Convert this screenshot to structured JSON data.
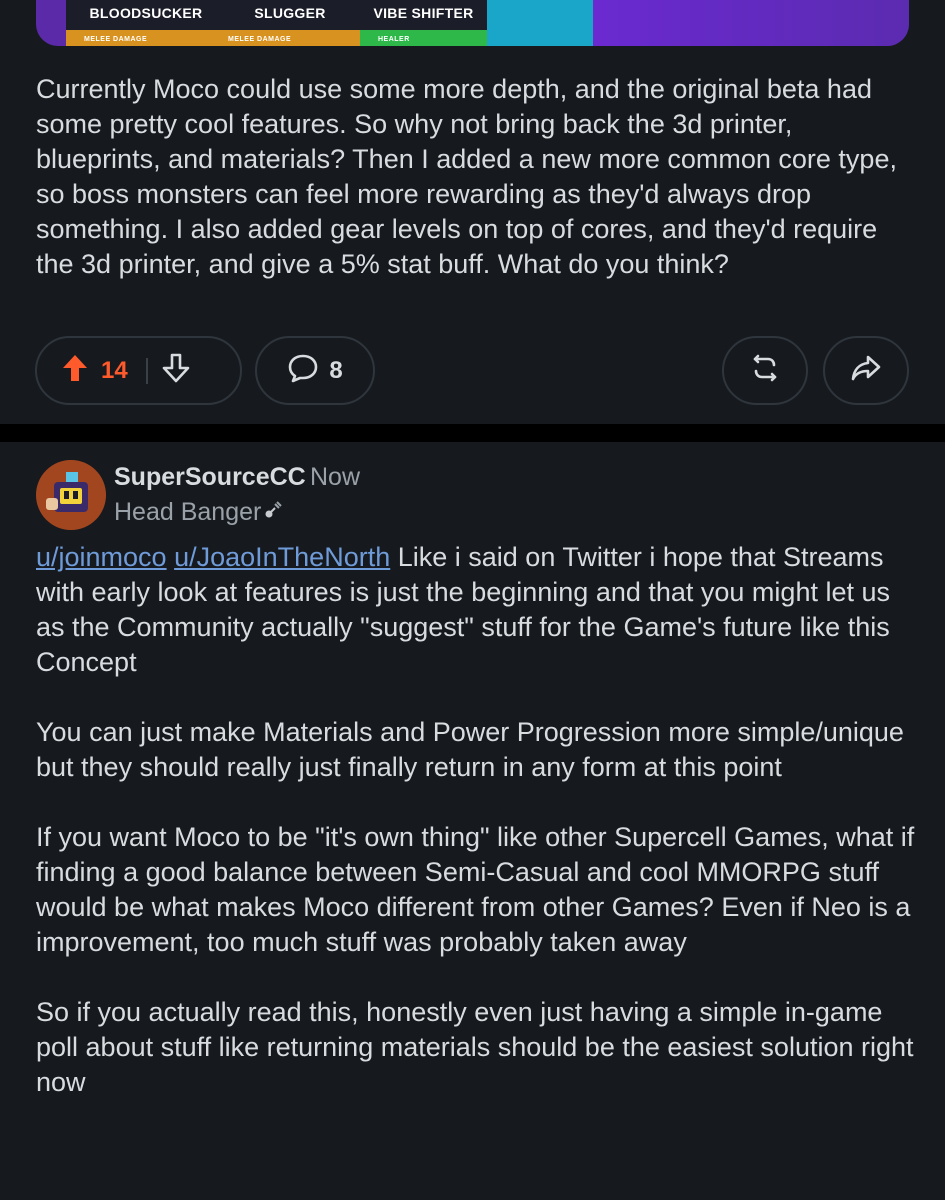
{
  "post": {
    "image_cards": [
      {
        "name": "BLOODSUCKER",
        "sub": "MELEE DAMAGE"
      },
      {
        "name": "SLUGGER",
        "sub": "MELEE DAMAGE"
      },
      {
        "name": "VIBE SHIFTER",
        "sub": "HEALER"
      }
    ],
    "body": "Currently Moco could use some more depth, and the original beta had some pretty cool features. So why not bring back the 3d printer, blueprints, and materials? Then I added a new more common core type, so boss monsters can feel more rewarding as they'd always drop something. I also added gear levels on top of cores, and they'd require the 3d printer, and give a 5% stat buff. What do you think?"
  },
  "actions": {
    "upvote_count": "14",
    "comment_count": "8",
    "upvote_icon": "arrow-up-icon",
    "downvote_icon": "arrow-down-icon",
    "comment_icon": "speech-bubble-icon",
    "award_icon": "crosspost-icon",
    "share_icon": "share-arrow-icon",
    "upvote_color": "#ff5a2b"
  },
  "comment": {
    "username": "SuperSourceCC",
    "timestamp": "Now",
    "flair": "Head Banger",
    "mention_1": "u/joinmoco",
    "mention_2": "u/JoaoInTheNorth",
    "para_1_rest": " Like i said on Twitter i hope that Streams with early look at features is just the beginning and that you might let us as the Community actually \"suggest\" stuff for the Game's future like this Concept",
    "para_2": "You can just make Materials and Power Progression more simple/unique but they should really just finally return in any form at this point",
    "para_3": "If you want Moco to be \"it's own thing\" like other Supercell Games, what if finding a good balance between Semi-Casual and cool MMORPG stuff would be what makes Moco different from other Games? Even if Neo is a improvement, too much stuff was probably taken away",
    "para_4": "So if you actually read this, honestly even just having a simple in-game poll about stuff like returning materials should be the easiest solution right now"
  },
  "colors": {
    "background": "#161a1f",
    "text": "#d9dcdf",
    "muted": "#9aa1a8",
    "link": "#6f9bd8"
  }
}
